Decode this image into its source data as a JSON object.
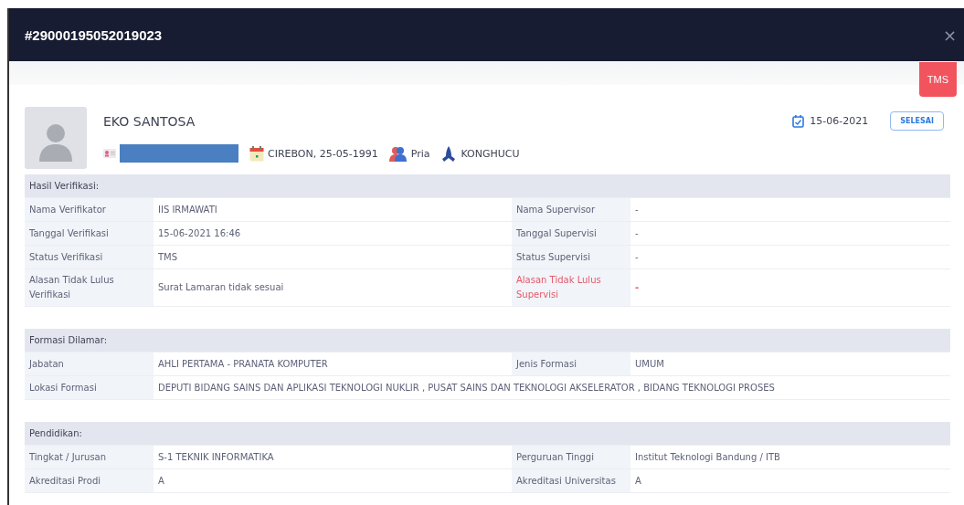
{
  "modal": {
    "title": "#29000195052019023",
    "close": "×"
  },
  "status_badge": "TMS",
  "profile": {
    "name": "EKO SANTOSA",
    "birth": "CIREBON, 25-05-1991",
    "gender": "Pria",
    "religion": "KONGHUCU",
    "date": "15-06-2021",
    "status": "SELESAI"
  },
  "sections": [
    {
      "title": "Hasil Verifikasi:",
      "rows": [
        [
          {
            "label": "Nama Verifikator",
            "value": "IIS IRMAWATI",
            "alert": false
          },
          {
            "label": "Nama Supervisor",
            "value": "-",
            "alert": false
          }
        ],
        [
          {
            "label": "Tanggal Verifikasi",
            "value": "15-06-2021 16:46",
            "alert": false
          },
          {
            "label": "Tanggal Supervisi",
            "value": "-",
            "alert": false
          }
        ],
        [
          {
            "label": "Status Verifikasi",
            "value": "TMS",
            "alert": false
          },
          {
            "label": "Status Supervisi",
            "value": "-",
            "alert": false
          }
        ],
        [
          {
            "label": "Alasan Tidak Lulus Verifikasi",
            "value": "Surat Lamaran tidak sesuai",
            "alert": false
          },
          {
            "label": "Alasan Tidak Lulus Supervisi",
            "value": "-",
            "alert": true
          }
        ]
      ]
    },
    {
      "title": "Formasi Dilamar:",
      "rows": [
        [
          {
            "label": "Jabatan",
            "value": "AHLI PERTAMA - PRANATA KOMPUTER",
            "alert": false
          },
          {
            "label": "Jenis Formasi",
            "value": "UMUM",
            "alert": false
          }
        ],
        [
          {
            "label": "Lokasi Formasi",
            "value": "DEPUTI BIDANG SAINS DAN APLIKASI TEKNOLOGI NUKLIR , PUSAT SAINS DAN TEKNOLOGI AKSELERATOR , BIDANG TEKNOLOGI PROSES",
            "alert": false
          }
        ]
      ]
    },
    {
      "title": "Pendidikan:",
      "rows": [
        [
          {
            "label": "Tingkat / Jurusan",
            "value": "S-1 TEKNIK INFORMATIKA",
            "alert": false
          },
          {
            "label": "Perguruan Tinggi",
            "value": "Institut Teknologi Bandung / ITB",
            "alert": false
          }
        ],
        [
          {
            "label": "Akreditasi Prodi",
            "value": "A",
            "alert": false
          },
          {
            "label": "Akreditasi Universitas",
            "value": "A",
            "alert": false
          }
        ]
      ]
    }
  ]
}
